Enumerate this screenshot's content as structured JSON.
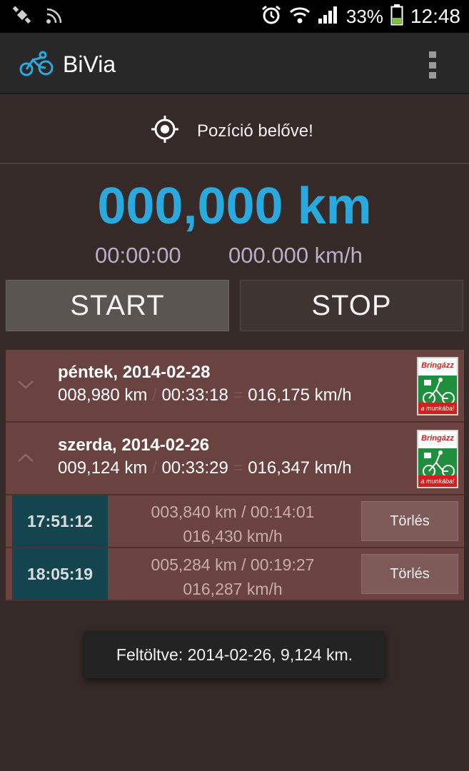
{
  "status_bar": {
    "battery": "33%",
    "time": "12:48",
    "icons": [
      "gps-icon",
      "nfc-icon",
      "alarm-icon",
      "wifi-icon",
      "signal-icon",
      "battery-icon"
    ]
  },
  "action_bar": {
    "title": "BiVia",
    "logo_icon": "bicycle-icon",
    "menu_icon": "overflow-menu-icon"
  },
  "position": {
    "icon": "crosshair-icon",
    "text": "Pozíció belőve!"
  },
  "tracker": {
    "distance": "000,000 km",
    "elapsed": "00:00:00",
    "speed": "000.000 km/h",
    "start_label": "START",
    "stop_label": "STOP"
  },
  "days": [
    {
      "title": "péntek, 2014-02-28",
      "distance": "008,980 km",
      "duration": "00:33:18",
      "speed": "016,175 km/h",
      "expanded": false,
      "badge_top": "Bringázz",
      "badge_bottom": "a munkába!"
    },
    {
      "title": "szerda, 2014-02-26",
      "distance": "009,124 km",
      "duration": "00:33:29",
      "speed": "016,347 km/h",
      "expanded": true,
      "badge_top": "Bringázz",
      "badge_bottom": "a munkába!",
      "trips": [
        {
          "time": "17:51:12",
          "distance": "003,840 km",
          "duration": "00:14:01",
          "speed": "016,430 km/h",
          "delete_label": "Törlés"
        },
        {
          "time": "18:05:19",
          "distance": "005,284 km",
          "duration": "00:19:27",
          "speed": "016,287 km/h",
          "delete_label": "Törlés"
        }
      ]
    }
  ],
  "separators": {
    "slash": "/",
    "equals": "="
  },
  "toast": {
    "text": "Feltöltve: 2014-02-26, 9,124 km."
  },
  "colors": {
    "accent": "#2aa9de",
    "background": "#352a28",
    "list_row": "#6a4240",
    "trip_time_bg": "#14444e",
    "badge_green": "#1f8f3e",
    "badge_red": "#d02020"
  }
}
